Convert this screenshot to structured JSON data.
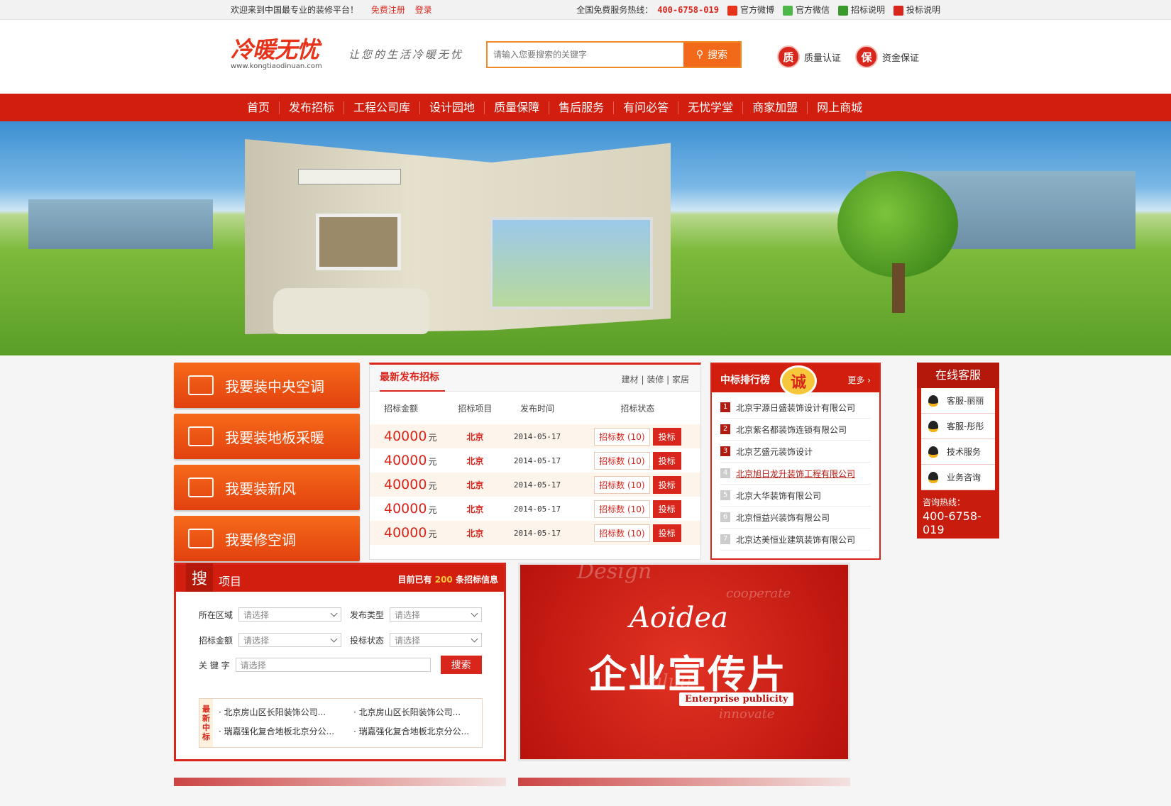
{
  "topbar": {
    "welcome": "欢迎来到中国最专业的装修平台！",
    "register": "免费注册",
    "login": "登录",
    "hotline_label": "全国免费服务热线：",
    "hotline": "400-6758-019",
    "links": [
      "官方微博",
      "官方微信",
      "招标说明",
      "投标说明"
    ]
  },
  "header": {
    "logo": "冷暖无忧",
    "logo_url": "www.kongtiaodinuan.com",
    "slogan": "让您的生活冷暖无忧",
    "search_placeholder": "请输入您要搜索的关键字",
    "search_button": "搜索",
    "cert1_badge": "质",
    "cert1_label": "质量认证",
    "cert2_badge": "保",
    "cert2_label": "资金保证"
  },
  "nav": [
    "首页",
    "发布招标",
    "工程公司库",
    "设计园地",
    "质量保障",
    "售后服务",
    "有问必答",
    "无忧学堂",
    "商家加盟",
    "网上商城"
  ],
  "services": [
    "我要装中央空调",
    "我要装地板采暖",
    "我要装新风",
    "我要修空调"
  ],
  "bids": {
    "title": "最新发布招标",
    "cats": "建材 | 装修 | 家居",
    "columns": [
      "招标金额",
      "招标项目",
      "发布时间",
      "招标状态"
    ],
    "rows": [
      {
        "amount": "40000",
        "unit": "元",
        "city": "北京",
        "date": "2014-05-17",
        "count": "招标数 (10)",
        "action": "投标"
      },
      {
        "amount": "40000",
        "unit": "元",
        "city": "北京",
        "date": "2014-05-17",
        "count": "招标数 (10)",
        "action": "投标"
      },
      {
        "amount": "40000",
        "unit": "元",
        "city": "北京",
        "date": "2014-05-17",
        "count": "招标数 (10)",
        "action": "投标"
      },
      {
        "amount": "40000",
        "unit": "元",
        "city": "北京",
        "date": "2014-05-17",
        "count": "招标数 (10)",
        "action": "投标"
      },
      {
        "amount": "40000",
        "unit": "元",
        "city": "北京",
        "date": "2014-05-17",
        "count": "招标数 (10)",
        "action": "投标"
      }
    ]
  },
  "rank": {
    "title": "中标排行榜",
    "badge": "诚",
    "more": "更多 ›",
    "items": [
      "北京宇源日盛装饰设计有限公司",
      "北京紫名都装饰连锁有限公司",
      "北京艺盛元装饰设计",
      "北京旭日龙升装饰工程有限公司",
      "北京大华装饰有限公司",
      "北京恒益兴装饰有限公司",
      "北京达美恒业建筑装饰有限公司"
    ]
  },
  "kf": {
    "title": "在线客服",
    "items": [
      "客服-丽丽",
      "客服-彤彤",
      "技术服务",
      "业务咨询"
    ],
    "hotline_label": "咨询热线：",
    "hotline": "400-6758-019"
  },
  "search_panel": {
    "icon": "搜",
    "title": "项目",
    "info_pre": "目前已有",
    "info_count": "200",
    "info_post": "条招标信息",
    "area_label": "所在区域",
    "type_label": "发布类型",
    "amount_label": "招标金额",
    "status_label": "投标状态",
    "keyword_label": "关 键 字",
    "placeholder": "请选择",
    "button": "搜索",
    "latest_label": "最新中标",
    "latest": [
      "北京房山区长阳装饰公司...",
      "北京房山区长阳装饰公司...",
      "瑞嘉强化复合地板北京分公...",
      "瑞嘉强化复合地板北京分公..."
    ]
  },
  "promo": {
    "script": "Aoidea",
    "title": "企业宣传片",
    "subtitle": "Enterprise publicity",
    "words": [
      "Design",
      "cooperate",
      "value",
      "innovate"
    ]
  }
}
